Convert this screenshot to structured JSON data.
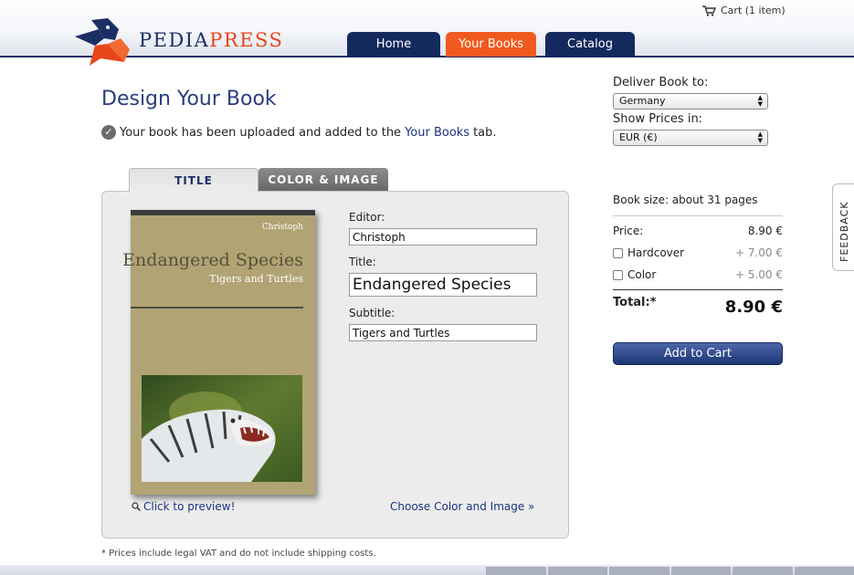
{
  "header": {
    "logo_text_part1": "PEDIA",
    "logo_text_part2": "PRESS",
    "cart_label": "Cart (1 item)",
    "nav": [
      "Home",
      "Your Books",
      "Catalog"
    ]
  },
  "main": {
    "title": "Design Your Book",
    "notice_prefix": "Your book has been uploaded and added to the",
    "notice_link": "Your Books",
    "notice_suffix": "tab.",
    "tabs": [
      "TITLE",
      "COLOR & IMAGE"
    ],
    "cover": {
      "editor": "Christoph",
      "title": "Endangered Species",
      "subtitle": "Tigers and Turtles"
    },
    "form": {
      "editor_label": "Editor:",
      "editor_value": "Christoph",
      "title_label": "Title:",
      "title_value": "Endangered Species",
      "subtitle_label": "Subtitle:",
      "subtitle_value": "Tigers and Turtles"
    },
    "preview_link": "Click to preview!",
    "choose_link": "Choose Color and Image »",
    "footnote": "* Prices include legal VAT and do not include shipping costs."
  },
  "sidebar": {
    "deliver_label": "Deliver Book to:",
    "deliver_value": "Germany",
    "prices_label": "Show Prices in:",
    "prices_value": "EUR (€)",
    "book_size": "Book size: about 31 pages",
    "price_label": "Price:",
    "price_value": "8.90 €",
    "hardcover_label": "Hardcover",
    "hardcover_value": "+ 7.00 €",
    "color_label": "Color",
    "color_value": "+ 5.00 €",
    "total_label": "Total:*",
    "total_value": "8.90 €",
    "add_to_cart": "Add to Cart",
    "feedback": "FEEDBACK"
  },
  "colors": {
    "brand_navy": "#1b2f66",
    "brand_orange": "#f05a1e",
    "cover": "#b1a373"
  }
}
